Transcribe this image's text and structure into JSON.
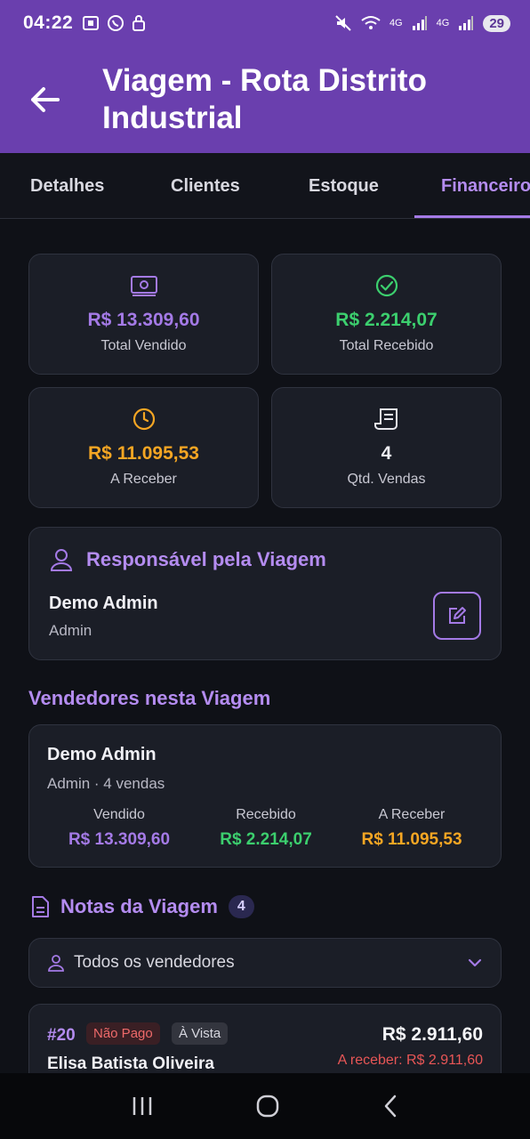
{
  "status_bar": {
    "time": "04:22",
    "network_1": "4G",
    "network_2": "4G",
    "battery": "29"
  },
  "app_bar": {
    "title": "Viagem - Rota Distrito Industrial"
  },
  "tabs": [
    {
      "label": "Detalhes"
    },
    {
      "label": "Clientes"
    },
    {
      "label": "Estoque"
    },
    {
      "label": "Financeiro"
    }
  ],
  "stats": {
    "total_vendido": {
      "value": "R$ 13.309,60",
      "label": "Total Vendido"
    },
    "total_recebido": {
      "value": "R$ 2.214,07",
      "label": "Total Recebido"
    },
    "a_receber": {
      "value": "R$ 11.095,53",
      "label": "A Receber"
    },
    "qtd_vendas": {
      "value": "4",
      "label": "Qtd. Vendas"
    }
  },
  "responsavel": {
    "title": "Responsável pela Viagem",
    "name": "Demo Admin",
    "role": "Admin"
  },
  "vendedores": {
    "title": "Vendedores nesta Viagem",
    "items": [
      {
        "name": "Demo Admin",
        "subtitle": "Admin · 4 vendas",
        "vendido_label": "Vendido",
        "vendido": "R$ 13.309,60",
        "recebido_label": "Recebido",
        "recebido": "R$ 2.214,07",
        "receber_label": "A Receber",
        "receber": "R$ 11.095,53"
      }
    ]
  },
  "notas": {
    "title": "Notas da Viagem",
    "count": "4",
    "filter": "Todos os vendedores",
    "items": [
      {
        "id": "#20",
        "status": "Não Pago",
        "payment": "À Vista",
        "client": "Elisa Batista Oliveira",
        "total": "R$ 2.911,60",
        "due": "A receber: R$ 2.911,60"
      }
    ]
  },
  "colors": {
    "primary": "#6a3fae",
    "accent": "#b48cf0",
    "green": "#3ccf6e",
    "orange": "#f5a623",
    "red": "#e85656"
  }
}
